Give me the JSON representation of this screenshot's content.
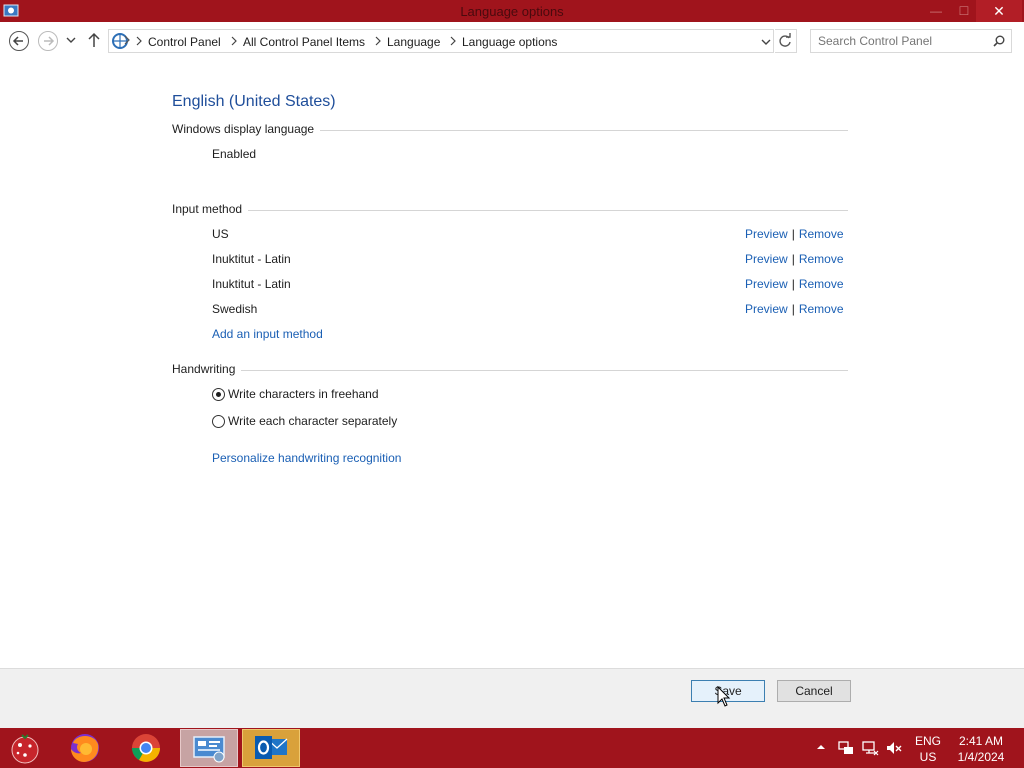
{
  "window": {
    "title": "Language options",
    "minimize_glyph": "—",
    "maximize_glyph": "☐",
    "close_glyph": "✕"
  },
  "address": {
    "breadcrumbs": [
      "Control Panel",
      "All Control Panel Items",
      "Language",
      "Language options"
    ],
    "search_placeholder": "Search Control Panel"
  },
  "main": {
    "language_name": "English (United States)",
    "display_language": {
      "heading": "Windows display language",
      "status": "Enabled"
    },
    "input_method": {
      "heading": "Input method",
      "methods": [
        {
          "name": "US",
          "preview": "Preview",
          "remove": "Remove"
        },
        {
          "name": "Inuktitut - Latin",
          "preview": "Preview",
          "remove": "Remove"
        },
        {
          "name": "Inuktitut - Latin",
          "preview": "Preview",
          "remove": "Remove"
        },
        {
          "name": "Swedish",
          "preview": "Preview",
          "remove": "Remove"
        }
      ],
      "separator": "|",
      "add_link": "Add an input method"
    },
    "handwriting": {
      "heading": "Handwriting",
      "options": [
        {
          "label": "Write characters in freehand",
          "selected": true
        },
        {
          "label": "Write each character separately",
          "selected": false
        }
      ],
      "personalize_link": "Personalize handwriting recognition"
    }
  },
  "footer": {
    "save_label": "Save",
    "cancel_label": "Cancel"
  },
  "taskbar": {
    "apps": [
      "start-orb-icon",
      "firefox-icon",
      "chrome-icon",
      "control-panel-icon",
      "outlook-icon"
    ],
    "language_line1": "ENG",
    "language_line2": "US",
    "time": "2:41 AM",
    "date": "1/4/2024"
  },
  "colors": {
    "accent": "#a0141c",
    "link": "#1a5fb4",
    "title_text": "#1f4e9a"
  }
}
